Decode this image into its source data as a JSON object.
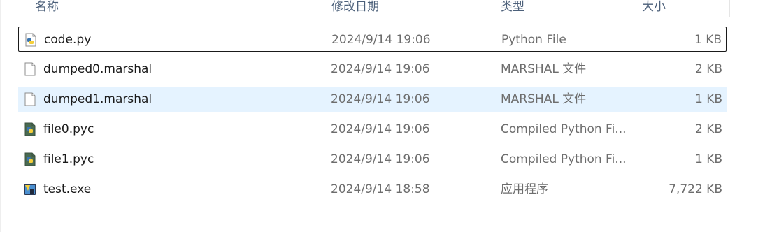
{
  "columns": {
    "name": "名称",
    "modified": "修改日期",
    "type": "类型",
    "size": "大小"
  },
  "files": [
    {
      "name": "code.py",
      "modified": "2024/9/14 19:06",
      "type": "Python File",
      "size": "1 KB",
      "icon": "python-file-icon"
    },
    {
      "name": "dumped0.marshal",
      "modified": "2024/9/14 19:06",
      "type": "MARSHAL 文件",
      "size": "2 KB",
      "icon": "blank-file-icon"
    },
    {
      "name": "dumped1.marshal",
      "modified": "2024/9/14 19:06",
      "type": "MARSHAL 文件",
      "size": "1 KB",
      "icon": "blank-file-icon"
    },
    {
      "name": "file0.pyc",
      "modified": "2024/9/14 19:06",
      "type": "Compiled Python Fi...",
      "size": "2 KB",
      "icon": "compiled-python-icon"
    },
    {
      "name": "file1.pyc",
      "modified": "2024/9/14 19:06",
      "type": "Compiled Python Fi...",
      "size": "1 KB",
      "icon": "compiled-python-icon"
    },
    {
      "name": "test.exe",
      "modified": "2024/9/14 18:58",
      "type": "应用程序",
      "size": "7,722 KB",
      "icon": "exe-app-icon"
    }
  ],
  "colors": {
    "selection": "#e5f3ff",
    "header_text": "#4c607a",
    "secondary_text": "#6d6d6d"
  }
}
